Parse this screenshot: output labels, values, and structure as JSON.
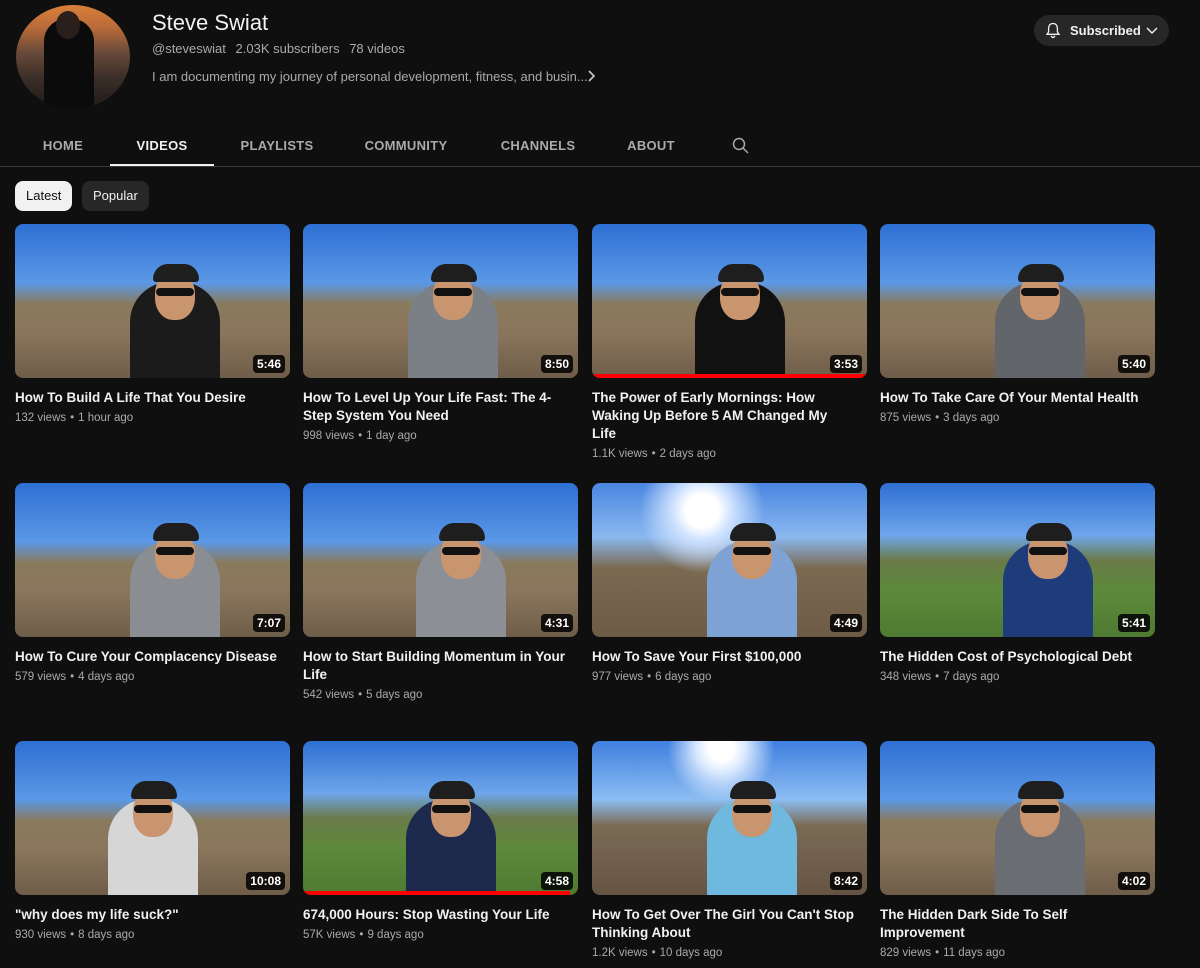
{
  "channel": {
    "name": "Steve Swiat",
    "handle": "@steveswiat",
    "subscribers": "2.03K subscribers",
    "video_count": "78 videos",
    "description": "I am documenting my journey of personal development, fitness, and busin...",
    "subscribe_label": "Subscribed"
  },
  "tabs": [
    {
      "label": "HOME",
      "active": false
    },
    {
      "label": "VIDEOS",
      "active": true
    },
    {
      "label": "PLAYLISTS",
      "active": false
    },
    {
      "label": "COMMUNITY",
      "active": false
    },
    {
      "label": "CHANNELS",
      "active": false
    },
    {
      "label": "ABOUT",
      "active": false
    }
  ],
  "chips": [
    {
      "label": "Latest",
      "active": true
    },
    {
      "label": "Popular",
      "active": false
    }
  ],
  "videos": [
    {
      "title": "How To Build A Life That You Desire",
      "views": "132 views",
      "age": "1 hour ago",
      "duration": "5:46",
      "watched": 0
    },
    {
      "title": "How To Level Up Your Life Fast: The 4-Step System You Need",
      "views": "998 views",
      "age": "1 day ago",
      "duration": "8:50",
      "watched": 0
    },
    {
      "title": "The Power of Early Mornings: How Waking Up Before 5 AM Changed My Life",
      "views": "1.1K views",
      "age": "2 days ago",
      "duration": "3:53",
      "watched": 1
    },
    {
      "title": "How To Take Care Of Your Mental Health",
      "views": "875 views",
      "age": "3 days ago",
      "duration": "5:40",
      "watched": 0
    },
    {
      "title": "How To Cure Your Complacency Disease",
      "views": "579 views",
      "age": "4 days ago",
      "duration": "7:07",
      "watched": 0
    },
    {
      "title": "How to Start Building Momentum in Your Life",
      "views": "542 views",
      "age": "5 days ago",
      "duration": "4:31",
      "watched": 0
    },
    {
      "title": "How To Save Your First $100,000",
      "views": "977 views",
      "age": "6 days ago",
      "duration": "4:49",
      "watched": 0
    },
    {
      "title": "The Hidden Cost of Psychological Debt",
      "views": "348 views",
      "age": "7 days ago",
      "duration": "5:41",
      "watched": 0
    },
    {
      "title": "\"why does my life suck?\"",
      "views": "930 views",
      "age": "8 days ago",
      "duration": "10:08",
      "watched": 0
    },
    {
      "title": "674,000 Hours: Stop Wasting Your Life",
      "views": "57K views",
      "age": "9 days ago",
      "duration": "4:58",
      "watched": 0.97
    },
    {
      "title": "How To Get Over The Girl You Can't Stop Thinking About",
      "views": "1.2K views",
      "age": "10 days ago",
      "duration": "8:42",
      "watched": 0
    },
    {
      "title": "The Hidden Dark Side To Self Improvement",
      "views": "829 views",
      "age": "11 days ago",
      "duration": "4:02",
      "watched": 0
    }
  ]
}
